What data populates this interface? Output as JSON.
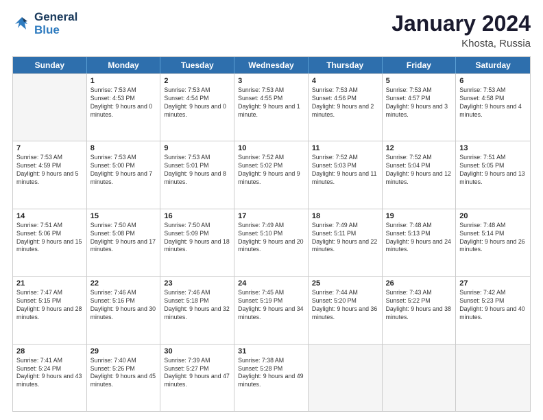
{
  "header": {
    "logo_line1": "General",
    "logo_line2": "Blue",
    "month_title": "January 2024",
    "location": "Khosta, Russia"
  },
  "days_of_week": [
    "Sunday",
    "Monday",
    "Tuesday",
    "Wednesday",
    "Thursday",
    "Friday",
    "Saturday"
  ],
  "weeks": [
    [
      {
        "day": "",
        "empty": true
      },
      {
        "day": "1",
        "sunrise": "Sunrise: 7:53 AM",
        "sunset": "Sunset: 4:53 PM",
        "daylight": "Daylight: 9 hours and 0 minutes."
      },
      {
        "day": "2",
        "sunrise": "Sunrise: 7:53 AM",
        "sunset": "Sunset: 4:54 PM",
        "daylight": "Daylight: 9 hours and 0 minutes."
      },
      {
        "day": "3",
        "sunrise": "Sunrise: 7:53 AM",
        "sunset": "Sunset: 4:55 PM",
        "daylight": "Daylight: 9 hours and 1 minute."
      },
      {
        "day": "4",
        "sunrise": "Sunrise: 7:53 AM",
        "sunset": "Sunset: 4:56 PM",
        "daylight": "Daylight: 9 hours and 2 minutes."
      },
      {
        "day": "5",
        "sunrise": "Sunrise: 7:53 AM",
        "sunset": "Sunset: 4:57 PM",
        "daylight": "Daylight: 9 hours and 3 minutes."
      },
      {
        "day": "6",
        "sunrise": "Sunrise: 7:53 AM",
        "sunset": "Sunset: 4:58 PM",
        "daylight": "Daylight: 9 hours and 4 minutes."
      }
    ],
    [
      {
        "day": "7",
        "sunrise": "Sunrise: 7:53 AM",
        "sunset": "Sunset: 4:59 PM",
        "daylight": "Daylight: 9 hours and 5 minutes."
      },
      {
        "day": "8",
        "sunrise": "Sunrise: 7:53 AM",
        "sunset": "Sunset: 5:00 PM",
        "daylight": "Daylight: 9 hours and 7 minutes."
      },
      {
        "day": "9",
        "sunrise": "Sunrise: 7:53 AM",
        "sunset": "Sunset: 5:01 PM",
        "daylight": "Daylight: 9 hours and 8 minutes."
      },
      {
        "day": "10",
        "sunrise": "Sunrise: 7:52 AM",
        "sunset": "Sunset: 5:02 PM",
        "daylight": "Daylight: 9 hours and 9 minutes."
      },
      {
        "day": "11",
        "sunrise": "Sunrise: 7:52 AM",
        "sunset": "Sunset: 5:03 PM",
        "daylight": "Daylight: 9 hours and 11 minutes."
      },
      {
        "day": "12",
        "sunrise": "Sunrise: 7:52 AM",
        "sunset": "Sunset: 5:04 PM",
        "daylight": "Daylight: 9 hours and 12 minutes."
      },
      {
        "day": "13",
        "sunrise": "Sunrise: 7:51 AM",
        "sunset": "Sunset: 5:05 PM",
        "daylight": "Daylight: 9 hours and 13 minutes."
      }
    ],
    [
      {
        "day": "14",
        "sunrise": "Sunrise: 7:51 AM",
        "sunset": "Sunset: 5:06 PM",
        "daylight": "Daylight: 9 hours and 15 minutes."
      },
      {
        "day": "15",
        "sunrise": "Sunrise: 7:50 AM",
        "sunset": "Sunset: 5:08 PM",
        "daylight": "Daylight: 9 hours and 17 minutes."
      },
      {
        "day": "16",
        "sunrise": "Sunrise: 7:50 AM",
        "sunset": "Sunset: 5:09 PM",
        "daylight": "Daylight: 9 hours and 18 minutes."
      },
      {
        "day": "17",
        "sunrise": "Sunrise: 7:49 AM",
        "sunset": "Sunset: 5:10 PM",
        "daylight": "Daylight: 9 hours and 20 minutes."
      },
      {
        "day": "18",
        "sunrise": "Sunrise: 7:49 AM",
        "sunset": "Sunset: 5:11 PM",
        "daylight": "Daylight: 9 hours and 22 minutes."
      },
      {
        "day": "19",
        "sunrise": "Sunrise: 7:48 AM",
        "sunset": "Sunset: 5:13 PM",
        "daylight": "Daylight: 9 hours and 24 minutes."
      },
      {
        "day": "20",
        "sunrise": "Sunrise: 7:48 AM",
        "sunset": "Sunset: 5:14 PM",
        "daylight": "Daylight: 9 hours and 26 minutes."
      }
    ],
    [
      {
        "day": "21",
        "sunrise": "Sunrise: 7:47 AM",
        "sunset": "Sunset: 5:15 PM",
        "daylight": "Daylight: 9 hours and 28 minutes."
      },
      {
        "day": "22",
        "sunrise": "Sunrise: 7:46 AM",
        "sunset": "Sunset: 5:16 PM",
        "daylight": "Daylight: 9 hours and 30 minutes."
      },
      {
        "day": "23",
        "sunrise": "Sunrise: 7:46 AM",
        "sunset": "Sunset: 5:18 PM",
        "daylight": "Daylight: 9 hours and 32 minutes."
      },
      {
        "day": "24",
        "sunrise": "Sunrise: 7:45 AM",
        "sunset": "Sunset: 5:19 PM",
        "daylight": "Daylight: 9 hours and 34 minutes."
      },
      {
        "day": "25",
        "sunrise": "Sunrise: 7:44 AM",
        "sunset": "Sunset: 5:20 PM",
        "daylight": "Daylight: 9 hours and 36 minutes."
      },
      {
        "day": "26",
        "sunrise": "Sunrise: 7:43 AM",
        "sunset": "Sunset: 5:22 PM",
        "daylight": "Daylight: 9 hours and 38 minutes."
      },
      {
        "day": "27",
        "sunrise": "Sunrise: 7:42 AM",
        "sunset": "Sunset: 5:23 PM",
        "daylight": "Daylight: 9 hours and 40 minutes."
      }
    ],
    [
      {
        "day": "28",
        "sunrise": "Sunrise: 7:41 AM",
        "sunset": "Sunset: 5:24 PM",
        "daylight": "Daylight: 9 hours and 43 minutes."
      },
      {
        "day": "29",
        "sunrise": "Sunrise: 7:40 AM",
        "sunset": "Sunset: 5:26 PM",
        "daylight": "Daylight: 9 hours and 45 minutes."
      },
      {
        "day": "30",
        "sunrise": "Sunrise: 7:39 AM",
        "sunset": "Sunset: 5:27 PM",
        "daylight": "Daylight: 9 hours and 47 minutes."
      },
      {
        "day": "31",
        "sunrise": "Sunrise: 7:38 AM",
        "sunset": "Sunset: 5:28 PM",
        "daylight": "Daylight: 9 hours and 49 minutes."
      },
      {
        "day": "",
        "empty": true
      },
      {
        "day": "",
        "empty": true
      },
      {
        "day": "",
        "empty": true
      }
    ]
  ]
}
